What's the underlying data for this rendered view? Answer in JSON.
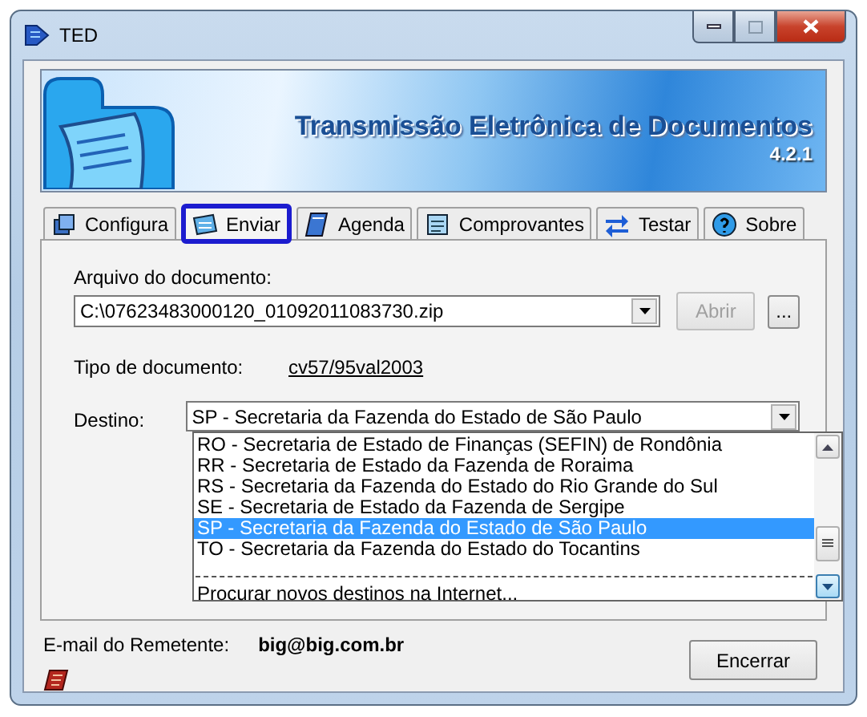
{
  "window": {
    "title": "TED"
  },
  "banner": {
    "title": "Transmissão Eletrônica de Documentos",
    "version": "4.2.1"
  },
  "tabs": [
    {
      "label": "Configura",
      "selected": false
    },
    {
      "label": "Enviar",
      "selected": true
    },
    {
      "label": "Agenda",
      "selected": false
    },
    {
      "label": "Comprovantes",
      "selected": false
    },
    {
      "label": "Testar",
      "selected": false
    },
    {
      "label": "Sobre",
      "selected": false
    }
  ],
  "file": {
    "label": "Arquivo do documento:",
    "value": "C:\\07623483000120_01092011083730.zip",
    "open_button": {
      "label": "Abrir",
      "disabled": true
    },
    "browse_button": "..."
  },
  "doc_type": {
    "label": "Tipo de documento:",
    "value": "cv57/95val2003"
  },
  "destination": {
    "label": "Destino:",
    "value": "SP - Secretaria da Fazenda do Estado de São Paulo",
    "options": [
      {
        "label": "RO - Secretaria de Estado de Finanças (SEFIN) de Rondônia",
        "selected": false
      },
      {
        "label": "RR - Secretaria de Estado da Fazenda de Roraima",
        "selected": false
      },
      {
        "label": "RS - Secretaria da Fazenda do Estado do Rio Grande do Sul",
        "selected": false
      },
      {
        "label": "SE - Secretaria de Estado da Fazenda de Sergipe",
        "selected": false
      },
      {
        "label": "SP - Secretaria da Fazenda do Estado de São Paulo",
        "selected": true
      },
      {
        "label": "TO - Secretaria da Fazenda do Estado do Tocantins",
        "selected": false
      }
    ],
    "search_option": "Procurar novos destinos na Internet..."
  },
  "sender": {
    "label": "E-mail do Remetente:",
    "value": "big@big.com.br"
  },
  "close_button": "Encerrar"
}
